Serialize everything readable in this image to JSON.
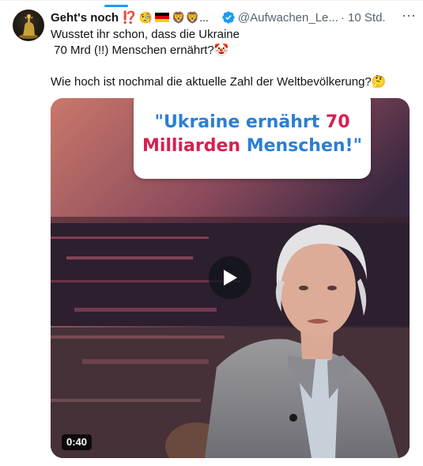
{
  "tweet": {
    "author": {
      "display_name": "Geht's noch ⁉️",
      "name_emojis": "🧐",
      "name_emojis_2": "🦁🦁...",
      "handle": "@Aufwachen_Le...",
      "time": "· 10 Std.",
      "verified": true
    },
    "more_icon": "⋯",
    "text_lines": [
      "Wusstet ihr schon, dass die Ukraine",
      " 70 Mrd (!!) Menschen ernährt?🤡",
      "Wie hoch ist nochmal die aktuelle Zahl der Weltbevölkerung?🤔"
    ],
    "video": {
      "banner_line1_a": "\"Ukraine ernährt ",
      "banner_line1_b": "70",
      "banner_line2_a": "Milliarden ",
      "banner_line2_b": "Menschen!\"",
      "duration": "0:40"
    }
  },
  "colors": {
    "accent": "#1d9bf0",
    "banner_blue": "#2a7fd4",
    "banner_red": "#d81f4e"
  },
  "icons": [
    "verified-badge-icon",
    "more-options-icon",
    "play-icon"
  ]
}
